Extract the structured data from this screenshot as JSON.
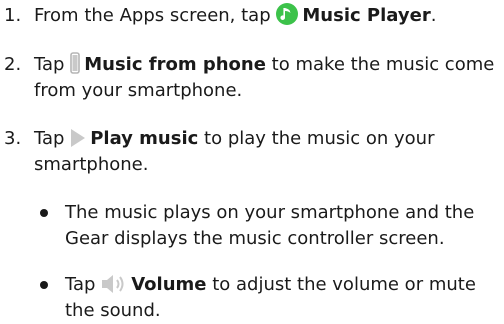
{
  "steps": [
    {
      "number": "1.",
      "before": "From the Apps screen, tap",
      "icon": "music-note-icon",
      "label": "Music Player",
      "after": "."
    },
    {
      "number": "2.",
      "before": "Tap",
      "icon": "phone-icon",
      "label": "Music from phone",
      "after": " to make the music come from your smartphone."
    },
    {
      "number": "3.",
      "before": "Tap",
      "icon": "play-icon",
      "label": "Play music",
      "after": " to play the music on your smartphone."
    }
  ],
  "bullets": [
    {
      "text": "The music plays on your smartphone and the Gear displays the music controller screen."
    },
    {
      "before": "Tap",
      "icon": "volume-icon",
      "label": "Volume",
      "after": " to adjust the volume or mute the sound."
    }
  ],
  "colors": {
    "music_icon": "#3cc24a",
    "grey_icon": "#c9c9c9",
    "text": "#1a1a1a"
  }
}
